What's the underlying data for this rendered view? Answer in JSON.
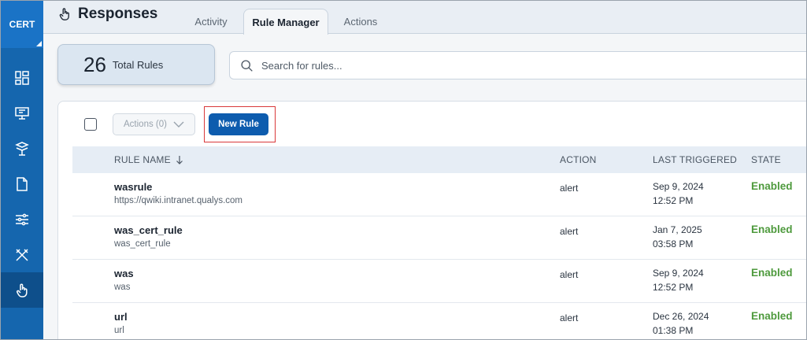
{
  "app": {
    "brand": "CERT",
    "accent": "#1566ae",
    "enabled_color": "#4e9a3d",
    "new_rule_color": "#0d5cae"
  },
  "nav": {
    "items": [
      {
        "name": "dashboard",
        "icon": "dashboard-icon"
      },
      {
        "name": "monitor",
        "icon": "monitor-icon"
      },
      {
        "name": "assets",
        "icon": "assets-icon"
      },
      {
        "name": "reports",
        "icon": "document-icon"
      },
      {
        "name": "configuration",
        "icon": "sliders-icon"
      },
      {
        "name": "tools",
        "icon": "tools-icon"
      },
      {
        "name": "responses",
        "icon": "hand-pointer-icon",
        "active": true
      }
    ]
  },
  "header": {
    "title": "Responses",
    "tabs": [
      {
        "label": "Activity"
      },
      {
        "label": "Rule Manager",
        "active": true
      },
      {
        "label": "Actions"
      }
    ]
  },
  "summary": {
    "count": "26",
    "label": "Total Rules"
  },
  "search": {
    "placeholder": "Search for rules..."
  },
  "toolbar": {
    "actions_label": "Actions (0)",
    "new_rule_label": "New Rule"
  },
  "table": {
    "columns": [
      "RULE NAME",
      "ACTION",
      "LAST TRIGGERED",
      "STATE"
    ],
    "rows": [
      {
        "name": "wasrule",
        "sub": "https://qwiki.intranet.qualys.com",
        "action": "alert",
        "date": "Sep 9, 2024",
        "time": "12:52 PM",
        "state": "Enabled"
      },
      {
        "name": "was_cert_rule",
        "sub": "was_cert_rule",
        "action": "alert",
        "date": "Jan 7, 2025",
        "time": "03:58 PM",
        "state": "Enabled"
      },
      {
        "name": "was",
        "sub": "was",
        "action": "alert",
        "date": "Sep 9, 2024",
        "time": "12:52 PM",
        "state": "Enabled"
      },
      {
        "name": "url",
        "sub": "url",
        "action": "alert",
        "date": "Dec 26, 2024",
        "time": "01:38 PM",
        "state": "Enabled"
      }
    ]
  }
}
